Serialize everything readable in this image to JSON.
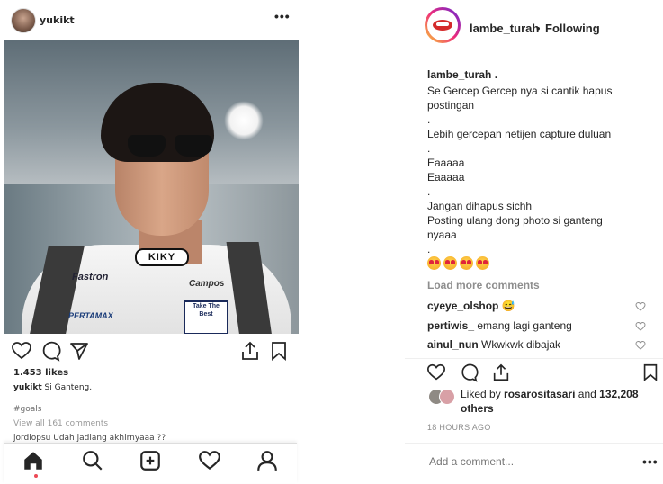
{
  "phone": {
    "username": "yukikt",
    "more": "•••",
    "photo": {
      "shirt_text_kiky": "KIKY",
      "shirt_text_fastron": "Fastron",
      "shirt_text_campos": "Campos",
      "shirt_text_pertamax": "PERTAMAX",
      "badge_text": "Take The Best"
    },
    "likes": "1.453 likes",
    "caption_user": "yukikt",
    "caption_text": "Si Ganteng.",
    "hashtag": "#goals",
    "view_all": "View all 161 comments",
    "partial_comment": "jordiopsu Udah jadiang akhirnyaaa ??",
    "nav": [
      "home-icon",
      "search-icon",
      "add-post-icon",
      "heart-icon",
      "profile-icon"
    ]
  },
  "post": {
    "username": "lambe_turah",
    "separator": "•",
    "follow_status": "Following",
    "caption_user": "lambe_turah .",
    "caption_lines": [
      "Se Gercep Gercep nya si cantik hapus",
      "postingan",
      ".",
      "Lebih gercepan netijen capture duluan",
      ".",
      "Eaaaaa",
      "Eaaaaa",
      ".",
      "Jangan dihapus sichh",
      "Posting ulang dong photo si ganteng",
      "nyaaa",
      "."
    ],
    "emojis": [
      "heart-eyes-emoji",
      "heart-eyes-emoji",
      "heart-eyes-emoji",
      "heart-eyes-emoji"
    ],
    "load_more": "Load more comments",
    "comments": [
      {
        "user": "cyeye_olshop",
        "text": "😅"
      },
      {
        "user": "pertiwis_",
        "text": "emang lagi ganteng"
      },
      {
        "user": "ainul_nun",
        "text": "Wkwkwk dibajak"
      }
    ],
    "liked_prefix": "Liked by",
    "liked_user": "rosarositasari",
    "liked_and": "and",
    "liked_others": "132,208 others",
    "time": "18 HOURS AGO",
    "add_comment_placeholder": "Add a comment...",
    "more": "•••"
  },
  "colors": {
    "text": "#262626",
    "muted": "#8e8e8e",
    "divider": "#efefef",
    "notification_dot": "#ed4956"
  }
}
